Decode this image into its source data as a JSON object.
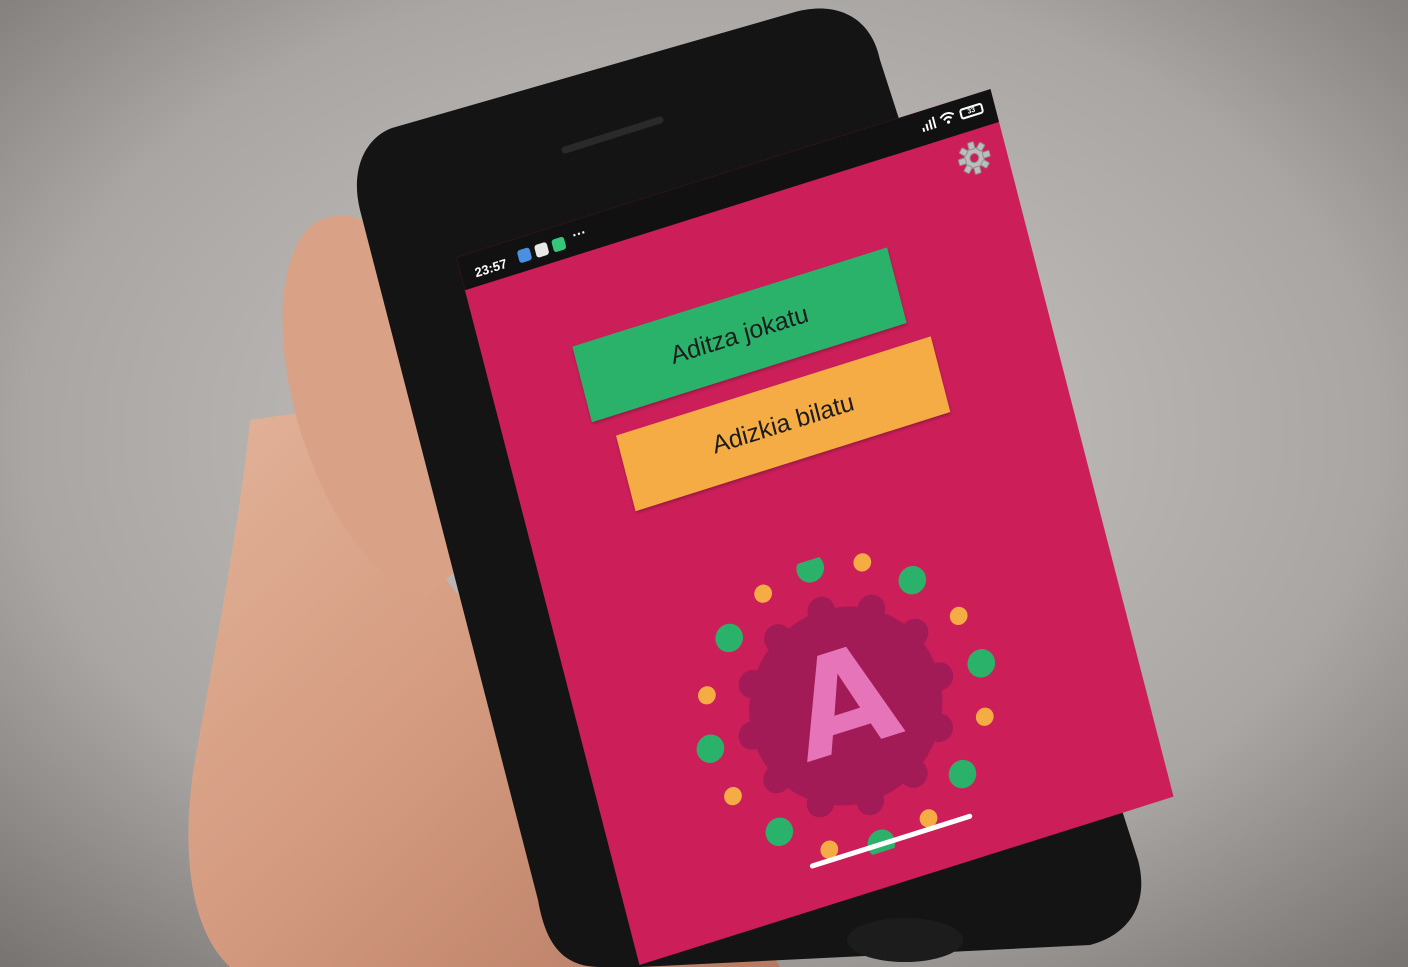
{
  "status_bar": {
    "time": "23:57",
    "more": "···",
    "battery": "33"
  },
  "buttons": {
    "conjugate_label": "Aditza jokatu",
    "search_label": "Adizkia bilatu"
  },
  "logo": {
    "letter": "A"
  },
  "icons": {
    "settings": "gear-icon",
    "signal": "signal-icon",
    "wifi": "wifi-icon",
    "battery": "battery-icon"
  },
  "colors": {
    "background": "#cc1f5a",
    "conjugate_button": "#2bb26a",
    "search_button": "#f5ac45",
    "badge": "#a21a56",
    "letter": "#e574b8",
    "dot_green": "#2bb26a",
    "dot_yellow": "#f5ac45"
  }
}
